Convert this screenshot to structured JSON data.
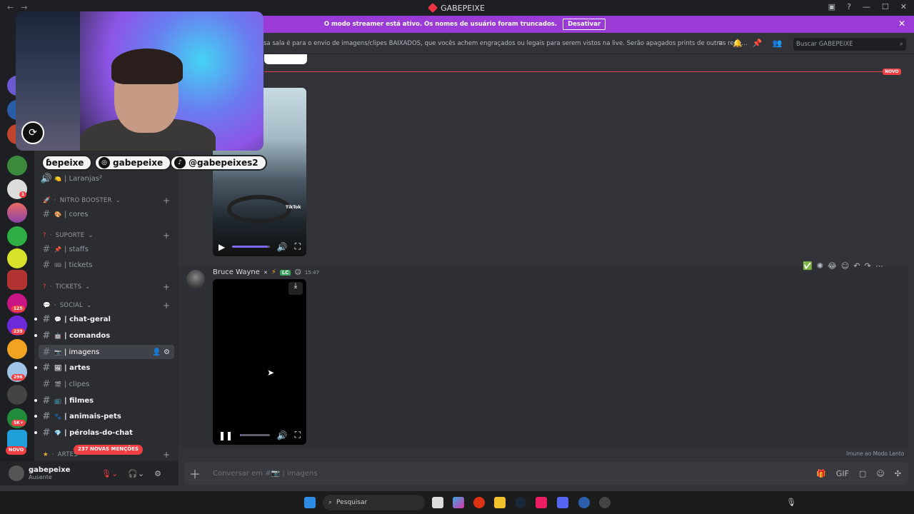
{
  "titlebar": {
    "title": "GABEPEIXE"
  },
  "banner": {
    "text": "O modo streamer está ativo. Os nomes de usuário foram truncados.",
    "button": "Desativar",
    "accent": "#9b3bd6"
  },
  "header": {
    "topic": "sa sala é para o envio de imagens/clipes BAIXADOS, que vocês achem engraçados ou legais para serem vistos na live. Serão apagados prints de outras rede...",
    "search_placeholder": "Buscar GABEPEIXE"
  },
  "guilds": {
    "badges": [
      "1",
      "125",
      "239",
      "296",
      "5K+"
    ],
    "novo": "NOVO"
  },
  "overlay": {
    "socials": [
      "ɓepeixe",
      "gabepeixe",
      "@gabepeixes2"
    ]
  },
  "channels": {
    "laranjas": "| Laranjas²",
    "cat_nitro": "NITRO BOOSTER",
    "cores": "| cores",
    "cat_suporte": "SUPORTE",
    "staffs": "| staffs",
    "tickets": "| tickets",
    "cat_tickets": "TICKETS",
    "cat_social": "SOCIAL",
    "chat_geral": "| chat-geral",
    "comandos": "| comandos",
    "imagens": "| imagens",
    "artes": "| artes",
    "clipes": "| clipes",
    "filmes": "| filmes",
    "animais_pets": "| animais-pets",
    "perolas": "| pérolas-do-chat",
    "cat_artes": "ARTES",
    "mentions": "237 NOVAS MENÇÕES"
  },
  "messages": {
    "new_label": "NOVO",
    "author": "Bruce Wayne",
    "author_tag": "LC",
    "time": "15:47",
    "tiktok_label": "TikTok",
    "video1_progress": 0.95,
    "video2_progress": 0.02
  },
  "slowmode": "Imune ao Modo Lento",
  "composer": {
    "placeholder": "Conversar em #📷 | imagens"
  },
  "user": {
    "name": "gabepeixe",
    "status": "Ausente"
  },
  "taskbar": {
    "search": "Pesquisar"
  }
}
